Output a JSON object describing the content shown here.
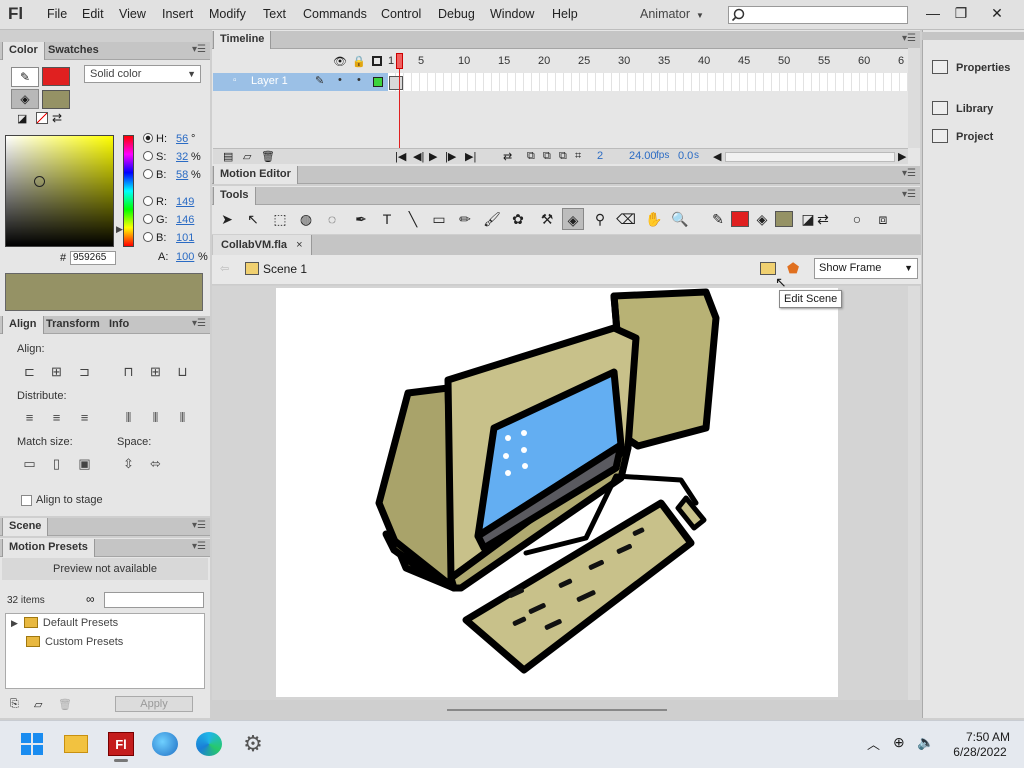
{
  "app": {
    "logo": "Fl"
  },
  "menu": [
    "File",
    "Edit",
    "View",
    "Insert",
    "Modify",
    "Text",
    "Commands",
    "Control",
    "Debug",
    "Window",
    "Help"
  ],
  "workspace": "Animator",
  "window_controls": {
    "minimize": "—",
    "restore": "❐",
    "close": "✕"
  },
  "color_panel": {
    "tabs": [
      "Color",
      "Swatches"
    ],
    "fill_type": "Solid color",
    "stroke_color": "#e02020",
    "fill_color": "#959265",
    "hsb": [
      {
        "label": "H:",
        "value": "56",
        "unit": "°"
      },
      {
        "label": "S:",
        "value": "32",
        "unit": "%"
      },
      {
        "label": "B:",
        "value": "58",
        "unit": "%"
      },
      {
        "label": "R:",
        "value": "149",
        "unit": ""
      },
      {
        "label": "G:",
        "value": "146",
        "unit": ""
      },
      {
        "label": "B:",
        "value": "101",
        "unit": ""
      }
    ],
    "hex_label": "#",
    "hex": "959265",
    "alpha_label": "A:",
    "alpha": "100",
    "alpha_unit": "%"
  },
  "align_panel": {
    "tabs": [
      "Align",
      "Transform",
      "Info"
    ],
    "align_label": "Align:",
    "distribute_label": "Distribute:",
    "match_label": "Match size:",
    "space_label": "Space:",
    "stage_label": "Align to stage"
  },
  "scene_panel": {
    "title": "Scene"
  },
  "motion_presets": {
    "title": "Motion Presets",
    "preview": "Preview not available",
    "count": "32 items",
    "folders": [
      "Default Presets",
      "Custom Presets"
    ],
    "apply": "Apply"
  },
  "timeline": {
    "title": "Timeline",
    "layer": "Layer 1",
    "frame_numbers": [
      "1",
      "5",
      "10",
      "15",
      "20",
      "25",
      "30",
      "35",
      "40",
      "45",
      "50",
      "55",
      "60",
      "6"
    ],
    "current_frame": "2",
    "fps": "24.00",
    "fps_unit": "fps",
    "time": "0.0",
    "time_unit": "s"
  },
  "motion_editor": {
    "title": "Motion Editor"
  },
  "tools": {
    "title": "Tools"
  },
  "document": {
    "tab": "CollabVM.fla",
    "close": "×",
    "scene": "Scene 1",
    "view_mode": "Show Frame",
    "tooltip": "Edit Scene"
  },
  "right_panel": [
    "Properties",
    "Library",
    "Project"
  ],
  "clock": {
    "time": "7:50 AM",
    "date": "6/28/2022"
  }
}
